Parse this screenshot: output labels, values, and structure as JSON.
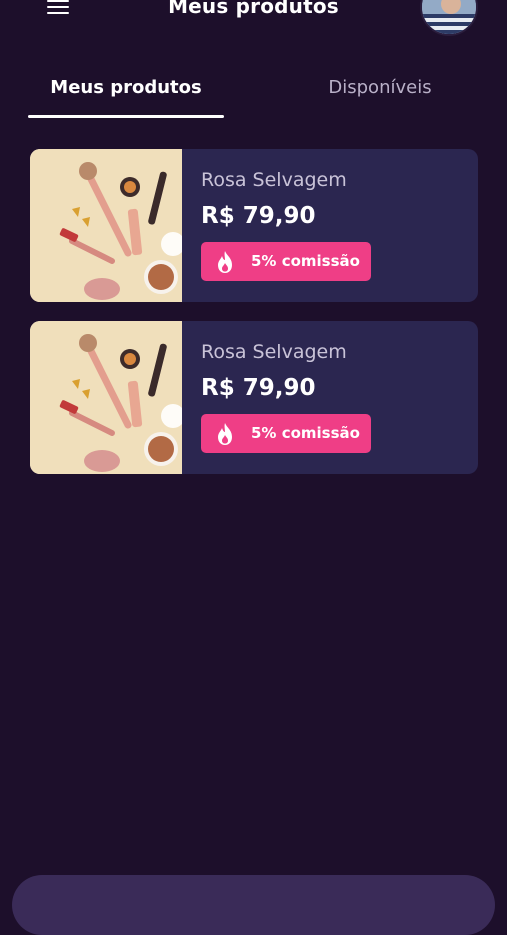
{
  "header": {
    "title": "Meus produtos"
  },
  "tabs": [
    {
      "label": "Meus produtos",
      "active": true
    },
    {
      "label": "Disponíveis",
      "active": false
    }
  ],
  "products": [
    {
      "name": "Rosa Selvagem",
      "price": "R$ 79,90",
      "commission": "5% comissão"
    },
    {
      "name": "Rosa Selvagem",
      "price": "R$ 79,90",
      "commission": "5% comissão"
    }
  ],
  "colors": {
    "background": "#1d0f2b",
    "card": "#2b2650",
    "accent": "#ef3e86"
  },
  "icons": {
    "menu": "hamburger-icon",
    "commission": "flame-icon"
  }
}
